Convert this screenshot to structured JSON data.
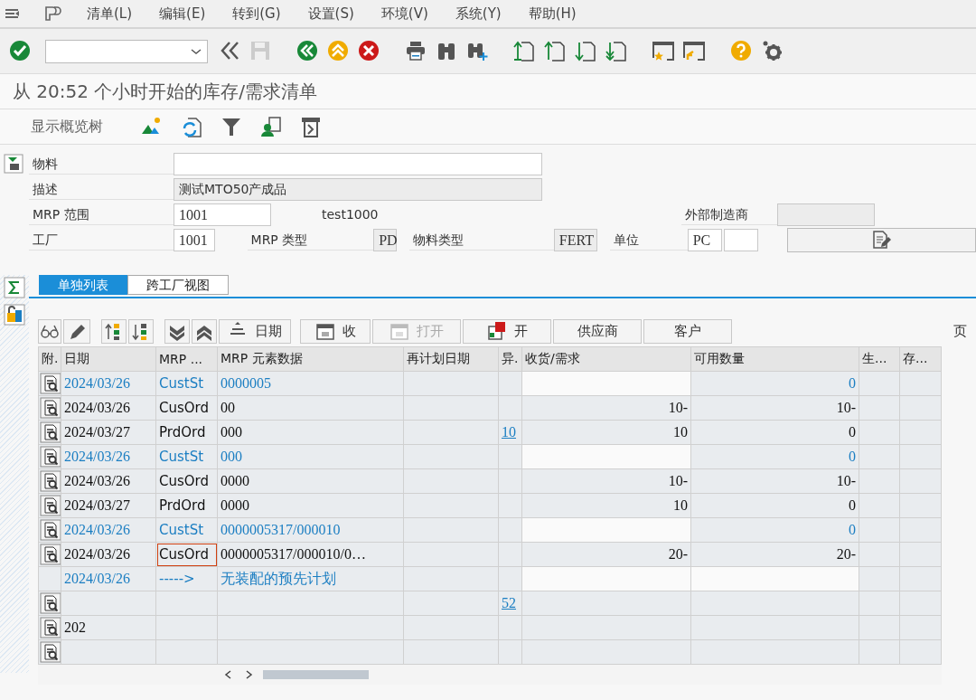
{
  "menu": {
    "items": [
      "清单(L)",
      "编辑(E)",
      "转到(G)",
      "设置(S)",
      "环境(V)",
      "系统(Y)",
      "帮助(H)"
    ]
  },
  "title": "从 20:52 个小时开始的库存/需求清单",
  "app_toolbar": {
    "label": "显示概览树"
  },
  "header": {
    "material_label": "物料",
    "description_label": "描述",
    "description": "测试MTO50产成品",
    "mrp_area_label": "MRP 范围",
    "mrp_area": "1001",
    "mrp_area_text": "test1000",
    "ext_manufacturer_label": "外部制造商",
    "plant_label": "工厂",
    "plant": "1001",
    "mrp_type_label": "MRP 类型",
    "mrp_type": "PD",
    "material_type_label": "物料类型",
    "material_type": "FERT",
    "unit_label": "单位",
    "unit": "PC"
  },
  "tabs": [
    {
      "label": "单独列表",
      "selected": true
    },
    {
      "label": "跨工厂视图",
      "selected": false
    }
  ],
  "grid_toolbar": {
    "buttons": [
      {
        "label": "日期",
        "disabled": false
      },
      {
        "label": "收",
        "disabled": false
      },
      {
        "label": "打开",
        "disabled": true
      },
      {
        "label": "开",
        "disabled": false
      },
      {
        "label": "供应商",
        "disabled": false
      },
      {
        "label": "客户",
        "disabled": false
      }
    ],
    "page_label": "页"
  },
  "table": {
    "columns": [
      "附.",
      "日期",
      "MRP ...",
      "MRP 元素数据",
      "再计划日期",
      "异.",
      "收货/需求",
      "可用数量",
      "生...",
      "存..."
    ],
    "rows": [
      {
        "kind": "stock",
        "has_icon": true,
        "focused": false,
        "date": "2024/03/26",
        "mrp": "CustSt",
        "data": "0000005",
        "exception": "",
        "receipt": "",
        "available": "0"
      },
      {
        "kind": "order",
        "has_icon": true,
        "focused": false,
        "date": "2024/03/26",
        "mrp": "CusOrd",
        "data": "00",
        "exception": "",
        "receipt": "10-",
        "available": "10-"
      },
      {
        "kind": "order",
        "has_icon": true,
        "focused": false,
        "date": "2024/03/27",
        "mrp": "PrdOrd",
        "data": "000",
        "exception": "10",
        "receipt": "10",
        "available": "0"
      },
      {
        "kind": "stock",
        "has_icon": true,
        "focused": false,
        "date": "2024/03/26",
        "mrp": "CustSt",
        "data": "000",
        "exception": "",
        "receipt": "",
        "available": "0"
      },
      {
        "kind": "order",
        "has_icon": true,
        "focused": false,
        "date": "2024/03/26",
        "mrp": "CusOrd",
        "data": "0000",
        "exception": "",
        "receipt": "10-",
        "available": "10-"
      },
      {
        "kind": "order",
        "has_icon": true,
        "focused": false,
        "date": "2024/03/27",
        "mrp": "PrdOrd",
        "data": "0000",
        "exception": "",
        "receipt": "10",
        "available": "0"
      },
      {
        "kind": "stock",
        "has_icon": true,
        "focused": false,
        "date": "2024/03/26",
        "mrp": "CustSt",
        "data": "0000005317/000010",
        "exception": "",
        "receipt": "",
        "available": "0"
      },
      {
        "kind": "order",
        "has_icon": true,
        "focused": true,
        "date": "2024/03/26",
        "mrp": "CusOrd",
        "data": "0000005317/000010/0…",
        "exception": "",
        "receipt": "20-",
        "available": "20-"
      },
      {
        "kind": "plan",
        "has_icon": false,
        "focused": false,
        "date": "2024/03/26",
        "mrp": "----->",
        "data": "无装配的预先计划",
        "exception": "",
        "receipt": "",
        "available": ""
      },
      {
        "kind": "order",
        "has_icon": true,
        "focused": false,
        "date": "",
        "mrp": "",
        "data": "",
        "exception": "52",
        "receipt": "",
        "available": ""
      },
      {
        "kind": "order",
        "has_icon": true,
        "focused": false,
        "date": "202",
        "mrp": "",
        "data": "",
        "exception": "",
        "receipt": "",
        "available": ""
      },
      {
        "kind": "order",
        "has_icon": true,
        "focused": false,
        "date": "",
        "mrp": "",
        "data": "",
        "exception": "",
        "receipt": "",
        "available": ""
      }
    ]
  }
}
